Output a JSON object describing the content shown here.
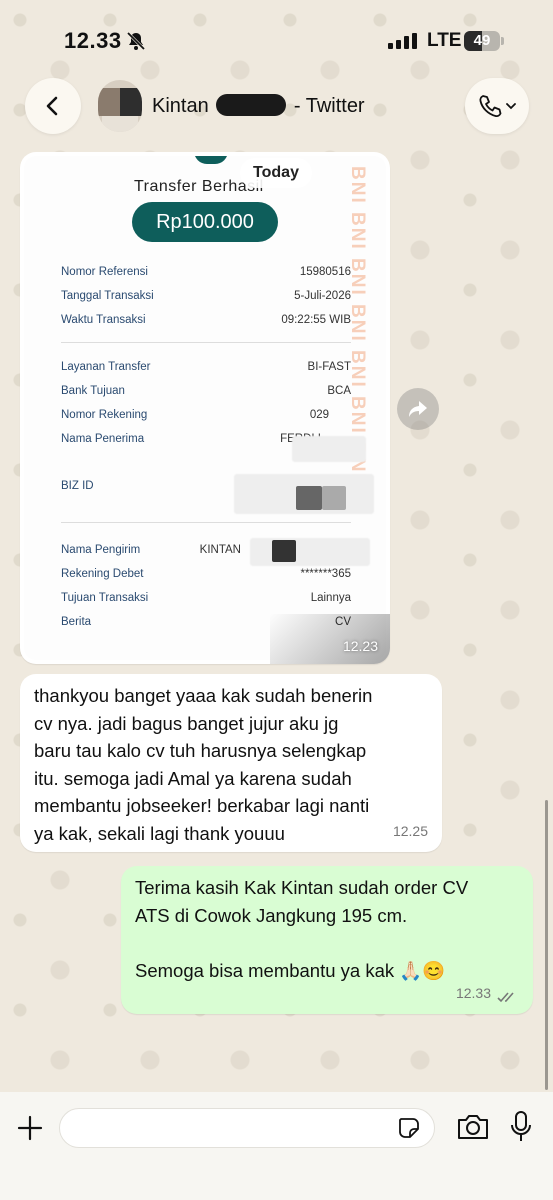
{
  "status_bar": {
    "time": "12.33",
    "network": "LTE",
    "battery_level": "49",
    "battery_fraction": 0.49
  },
  "header": {
    "contact_name_prefix": "Kintan",
    "contact_name_suffix": "- Twitter"
  },
  "receipt": {
    "title": "Transfer Berhasil",
    "amount": "Rp100.000",
    "watermark": "BNI BNI BNI BNI BNI BNI BNI",
    "rows_group1": [
      {
        "label": "Nomor Referensi",
        "value": "15980516"
      },
      {
        "label": "Tanggal Transaksi",
        "value": "5-Juli-2026"
      },
      {
        "label": "Waktu Transaksi",
        "value": "09:22:55 WIB"
      }
    ],
    "rows_group2": [
      {
        "label": "Layanan Transfer",
        "value": "BI-FAST"
      },
      {
        "label": "Bank Tujuan",
        "value": "BCA"
      },
      {
        "label": "Nomor Rekening",
        "value": "029"
      },
      {
        "label": "Nama Penerima",
        "value": "FERDI I"
      }
    ],
    "biz_id_label": "BIZ ID",
    "rows_group3": [
      {
        "label": "Nama Pengirim",
        "value": "KINTAN"
      },
      {
        "label": "Rekening Debet",
        "value": "*******365"
      },
      {
        "label": "Tujuan Transaksi",
        "value": "Lainnya"
      },
      {
        "label": "Berita",
        "value": "CV"
      }
    ]
  },
  "date_chip": "Today",
  "messages": {
    "image_time": "12.23",
    "incoming_text": "thankyou banget yaaa kak sudah benerin\ncv nya. jadi bagus banget jujur aku jg\nbaru tau kalo cv tuh harusnya selengkap\nitu. semoga jadi Amal ya karena sudah\nmembantu jobseeker! berkabar lagi nanti\nya kak, sekali lagi thank youuu",
    "incoming_time": "12.25",
    "outgoing_text": "Terima kasih Kak Kintan sudah order CV\nATS di Cowok Jangkung 195 cm.\n\nSemoga bisa membantu ya kak 🙏🏻😊",
    "outgoing_time": "12.33"
  },
  "composer": {
    "placeholder": ""
  },
  "icons": {
    "back": "chevron-left-icon",
    "call": "phone-icon",
    "forward": "forward-icon",
    "plus": "plus-icon",
    "sticker": "sticker-icon",
    "camera": "camera-icon",
    "mic": "microphone-icon",
    "read_receipt": "double-check-icon",
    "silent": "bell-slash-icon"
  },
  "colors": {
    "chat_bg": "#efe9de",
    "incoming_bubble": "#ffffff",
    "outgoing_bubble": "#d9fdd3",
    "bni_teal": "#0e5e5b"
  }
}
